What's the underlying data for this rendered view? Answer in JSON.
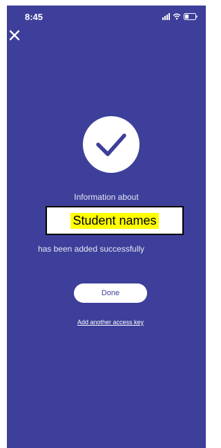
{
  "status_bar": {
    "time": "8:45",
    "icons": [
      "signal-icon",
      "wifi-icon",
      "battery-icon"
    ]
  },
  "header": {
    "close_icon": "close-icon"
  },
  "success": {
    "icon": "checkmark-icon",
    "line_1": "Information about",
    "highlight": "Student names",
    "line_2": "has been added successfully"
  },
  "actions": {
    "done_label": "Done",
    "link_label": "Add another access key"
  },
  "colors": {
    "background": "#3d3f9a",
    "text": "#ffffff",
    "highlight": "#ffff00"
  }
}
